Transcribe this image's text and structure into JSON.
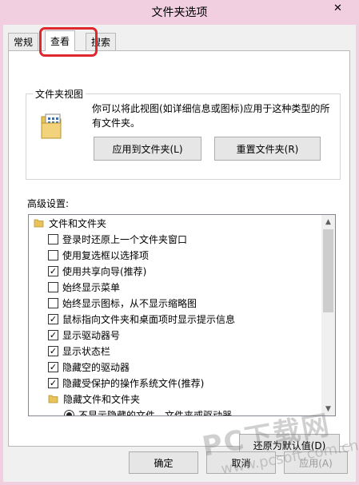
{
  "window": {
    "title": "文件夹选项",
    "close_glyph": "✕"
  },
  "tabs": [
    {
      "label": "常规",
      "active": false
    },
    {
      "label": "查看",
      "active": true
    },
    {
      "label": "搜索",
      "active": false
    }
  ],
  "folder_views": {
    "label": "文件夹视图",
    "description": "你可以将此视图(如详细信息或图标)应用于这种类型的所有文件夹。",
    "apply_button": "应用到文件夹(L)",
    "reset_button": "重置文件夹(R)"
  },
  "advanced": {
    "label": "高级设置:",
    "items": [
      {
        "type": "folder",
        "label": "文件和文件夹"
      },
      {
        "type": "checkbox",
        "label": "登录时还原上一个文件夹窗口",
        "checked": false
      },
      {
        "type": "checkbox",
        "label": "使用复选框以选择项",
        "checked": false
      },
      {
        "type": "checkbox",
        "label": "使用共享向导(推荐)",
        "checked": true
      },
      {
        "type": "checkbox",
        "label": "始终显示菜单",
        "checked": false
      },
      {
        "type": "checkbox",
        "label": "始终显示图标，从不显示缩略图",
        "checked": false
      },
      {
        "type": "checkbox",
        "label": "鼠标指向文件夹和桌面项时显示提示信息",
        "checked": true
      },
      {
        "type": "checkbox",
        "label": "显示驱动器号",
        "checked": true
      },
      {
        "type": "checkbox",
        "label": "显示状态栏",
        "checked": true
      },
      {
        "type": "checkbox",
        "label": "隐藏空的驱动器",
        "checked": true
      },
      {
        "type": "checkbox",
        "label": "隐藏受保护的操作系统文件(推荐)",
        "checked": true
      },
      {
        "type": "folder",
        "label": "隐藏文件和文件夹"
      },
      {
        "type": "radio",
        "label": "不显示隐藏的文件、文件夹或驱动器",
        "checked": true
      }
    ],
    "restore_button": "还原为默认值(D)"
  },
  "footer": {
    "ok_button": "确定",
    "cancel_button": "取消",
    "apply_button": "应用(A)"
  },
  "watermark": {
    "line1": "PC下载网",
    "line2": "www.pcsoft.com.cn"
  },
  "colors": {
    "title_bar": "#f1cfe0",
    "highlight": "#e0272d",
    "folder": "#e9c357"
  }
}
